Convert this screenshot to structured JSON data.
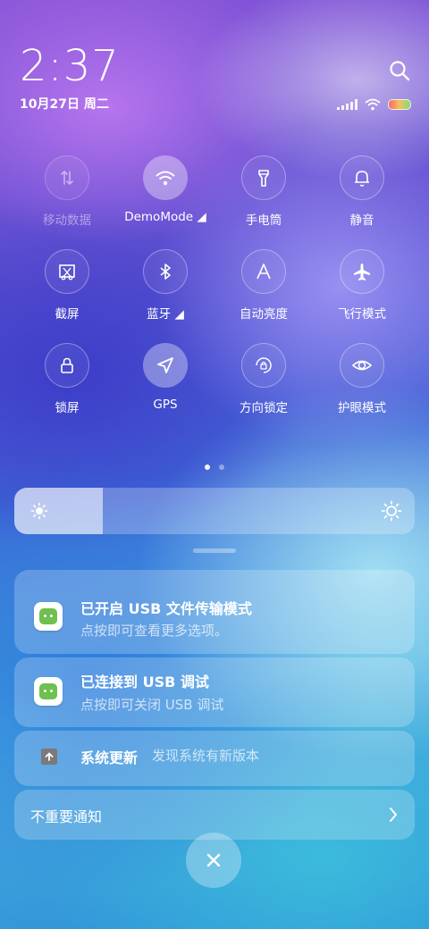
{
  "status_bar": {
    "time": "2:37",
    "date": "10月27日 周二"
  },
  "tiles": [
    {
      "label": "移动数据",
      "icon": "mobile-data-icon",
      "state": "disabled"
    },
    {
      "label": "DemoMode ◢",
      "icon": "wifi-icon",
      "state": "on"
    },
    {
      "label": "手电筒",
      "icon": "flashlight-icon",
      "state": "off"
    },
    {
      "label": "静音",
      "icon": "bell-icon",
      "state": "off"
    },
    {
      "label": "截屏",
      "icon": "screenshot-icon",
      "state": "off"
    },
    {
      "label": "蓝牙 ◢",
      "icon": "bluetooth-icon",
      "state": "off"
    },
    {
      "label": "自动亮度",
      "icon": "auto-brightness-icon",
      "state": "off"
    },
    {
      "label": "飞行模式",
      "icon": "airplane-icon",
      "state": "off"
    },
    {
      "label": "锁屏",
      "icon": "lock-icon",
      "state": "off"
    },
    {
      "label": "GPS",
      "icon": "location-arrow-icon",
      "state": "on"
    },
    {
      "label": "方向锁定",
      "icon": "rotation-lock-icon",
      "state": "off"
    },
    {
      "label": "护眼模式",
      "icon": "eye-icon",
      "state": "off"
    }
  ],
  "page_indicator": {
    "pages": 2,
    "active": 1
  },
  "brightness": {
    "level": 0.22
  },
  "notifications": {
    "usb_transfer": {
      "title": "已开启 USB 文件传输模式",
      "subtitle": "点按即可查看更多选项。",
      "icon": "android-icon"
    },
    "usb_debug": {
      "title": "已连接到 USB 调试",
      "subtitle": "点按即可关闭 USB 调试",
      "icon": "android-icon"
    },
    "system_update": {
      "title": "系统更新",
      "subtitle": "发现系统有新版本",
      "icon": "update-arrow-icon"
    },
    "unimportant": {
      "label": "不重要通知",
      "icon": "chevron-right-icon"
    }
  },
  "colors": {
    "accent": "#ffffff",
    "android_green": "#6fc04f"
  }
}
